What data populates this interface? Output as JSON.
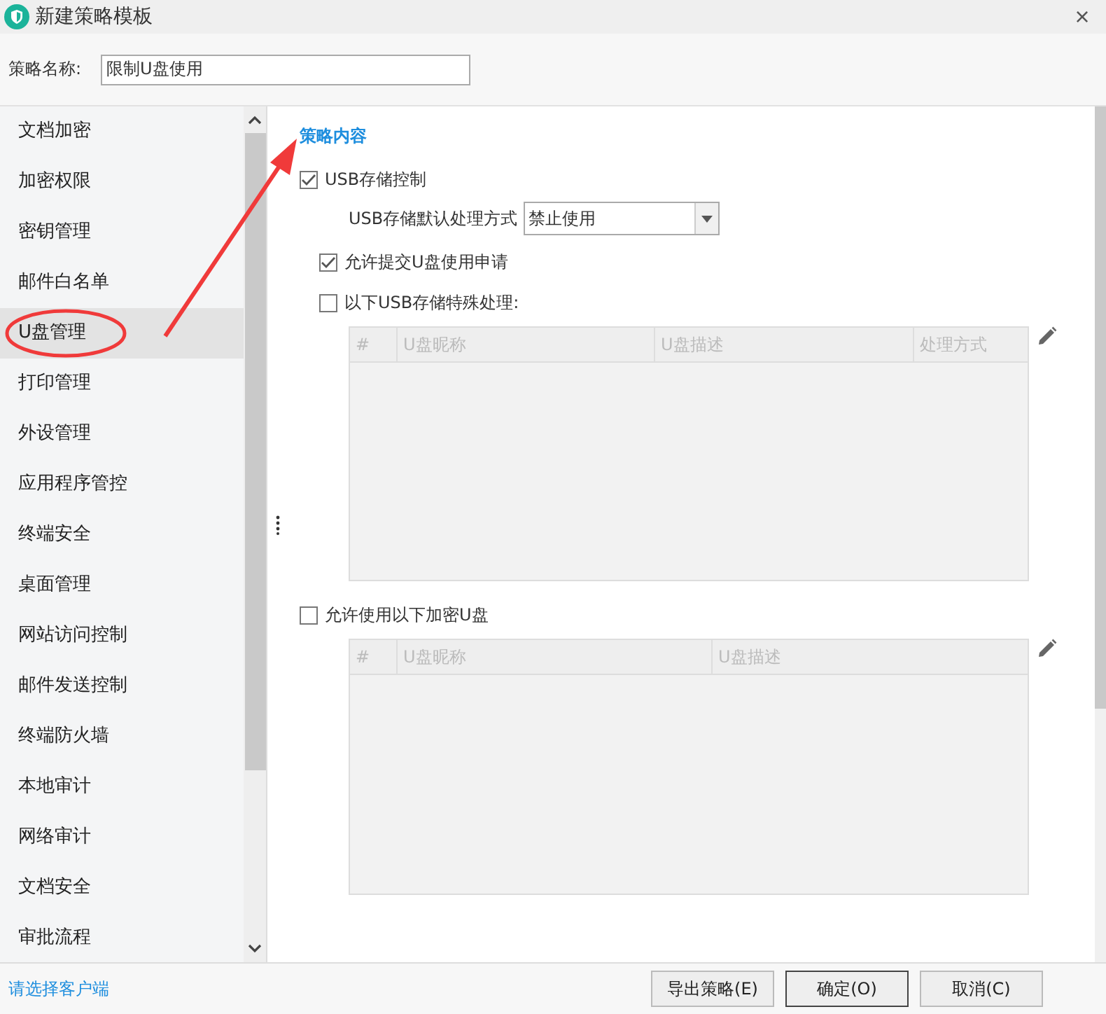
{
  "window": {
    "title": "新建策略模板",
    "close": "×"
  },
  "name_field": {
    "label": "策略名称:",
    "value": "限制U盘使用"
  },
  "sidebar": {
    "items": [
      {
        "label": "文档加密",
        "selected": false
      },
      {
        "label": "加密权限",
        "selected": false
      },
      {
        "label": "密钥管理",
        "selected": false
      },
      {
        "label": "邮件白名单",
        "selected": false
      },
      {
        "label": "U盘管理",
        "selected": true
      },
      {
        "label": "打印管理",
        "selected": false
      },
      {
        "label": "外设管理",
        "selected": false
      },
      {
        "label": "应用程序管控",
        "selected": false
      },
      {
        "label": "终端安全",
        "selected": false
      },
      {
        "label": "桌面管理",
        "selected": false
      },
      {
        "label": "网站访问控制",
        "selected": false
      },
      {
        "label": "邮件发送控制",
        "selected": false
      },
      {
        "label": "终端防火墙",
        "selected": false
      },
      {
        "label": "本地审计",
        "selected": false
      },
      {
        "label": "网络审计",
        "selected": false
      },
      {
        "label": "文档安全",
        "selected": false
      },
      {
        "label": "审批流程",
        "selected": false
      }
    ]
  },
  "content": {
    "heading": "策略内容",
    "usb_control": {
      "label": "USB存储控制",
      "checked": true
    },
    "default_mode": {
      "label": "USB存储默认处理方式",
      "value": "禁止使用"
    },
    "allow_request": {
      "label": "允许提交U盘使用申请",
      "checked": true
    },
    "special": {
      "label": "以下USB存储特殊处理:",
      "checked": false
    },
    "special_table": {
      "columns": [
        "#",
        "U盘昵称",
        "U盘描述",
        "处理方式"
      ]
    },
    "encrypted": {
      "label": "允许使用以下加密U盘",
      "checked": false
    },
    "encrypted_table": {
      "columns": [
        "#",
        "U盘昵称",
        "U盘描述"
      ]
    }
  },
  "footer": {
    "link": "请选择客户端",
    "buttons": [
      "导出策略(E)",
      "确定(O)",
      "取消(C)"
    ]
  }
}
